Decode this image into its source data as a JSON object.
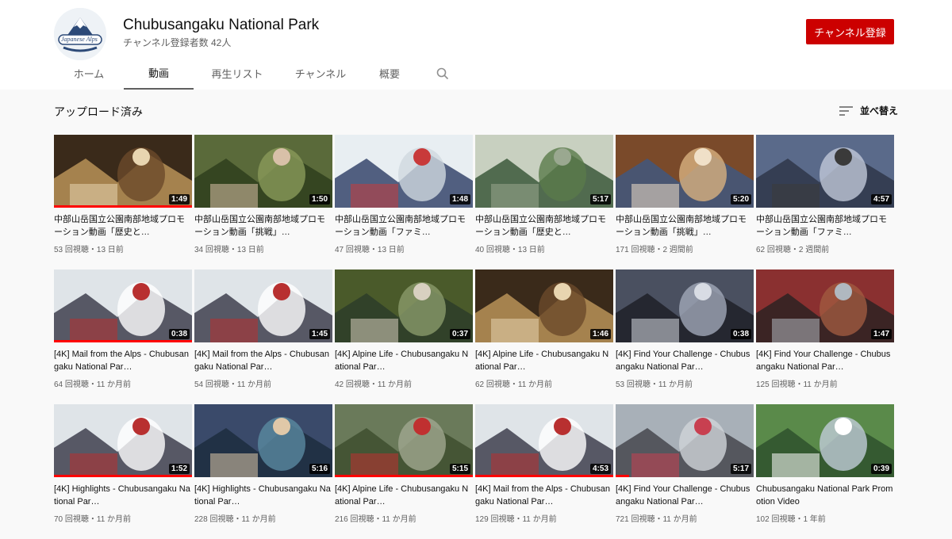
{
  "header": {
    "channel_name": "Chubusangaku National Park",
    "subscriber_count": "チャンネル登録者数 42人",
    "subscribe_label": "チャンネル登録",
    "avatar_text": "Japanese Alps"
  },
  "tabs": [
    {
      "label": "ホーム"
    },
    {
      "label": "動画"
    },
    {
      "label": "再生リスト"
    },
    {
      "label": "チャンネル"
    },
    {
      "label": "概要"
    }
  ],
  "section": {
    "title": "アップロード済み",
    "sort_label": "並べ替え"
  },
  "colors": {
    "subscribe": "#cc0000",
    "progress": "#ff0000"
  },
  "videos": [
    {
      "title": "中部山岳国立公園南部地域プロモーション動画「歴史と…",
      "meta": "53 回視聴・13 日前",
      "duration": "1:49",
      "progress": 1.0
    },
    {
      "title": "中部山岳国立公園南部地域プロモーション動画「挑戦」…",
      "meta": "34 回視聴・13 日前",
      "duration": "1:50",
      "progress": 0
    },
    {
      "title": "中部山岳国立公園南部地域プロモーション動画「ファミ…",
      "meta": "47 回視聴・13 日前",
      "duration": "1:48",
      "progress": 0
    },
    {
      "title": "中部山岳国立公園南部地域プロモーション動画「歴史と…",
      "meta": "40 回視聴・13 日前",
      "duration": "5:17",
      "progress": 0
    },
    {
      "title": "中部山岳国立公園南部地域プロモーション動画「挑戦」…",
      "meta": "171 回視聴・2 週間前",
      "duration": "5:20",
      "progress": 0
    },
    {
      "title": "中部山岳国立公園南部地域プロモーション動画「ファミ…",
      "meta": "62 回視聴・2 週間前",
      "duration": "4:57",
      "progress": 0
    },
    {
      "title": "[4K] Mail from the Alps - Chubusangaku National Par…",
      "meta": "64 回視聴・11 か月前",
      "duration": "0:38",
      "progress": 1.0
    },
    {
      "title": "[4K] Mail from the Alps - Chubusangaku National Par…",
      "meta": "54 回視聴・11 か月前",
      "duration": "1:45",
      "progress": 0
    },
    {
      "title": "[4K] Alpine Life - Chubusangaku National Par…",
      "meta": "42 回視聴・11 か月前",
      "duration": "0:37",
      "progress": 0
    },
    {
      "title": "[4K] Alpine Life - Chubusangaku National Par…",
      "meta": "62 回視聴・11 か月前",
      "duration": "1:46",
      "progress": 0
    },
    {
      "title": "[4K] Find Your Challenge - Chubusangaku National Par…",
      "meta": "53 回視聴・11 か月前",
      "duration": "0:38",
      "progress": 0
    },
    {
      "title": "[4K] Find Your Challenge - Chubusangaku National Par…",
      "meta": "125 回視聴・11 か月前",
      "duration": "1:47",
      "progress": 0
    },
    {
      "title": "[4K] Highlights - Chubusangaku National Par…",
      "meta": "70 回視聴・11 か月前",
      "duration": "1:52",
      "progress": 1.0
    },
    {
      "title": "[4K] Highlights - Chubusangaku National Par…",
      "meta": "228 回視聴・11 か月前",
      "duration": "5:16",
      "progress": 0
    },
    {
      "title": "[4K] Alpine Life - Chubusangaku National Par…",
      "meta": "216 回視聴・11 か月前",
      "duration": "5:15",
      "progress": 1.0
    },
    {
      "title": "[4K] Mail from the Alps - Chubusangaku National Par…",
      "meta": "129 回視聴・11 か月前",
      "duration": "4:53",
      "progress": 1.0
    },
    {
      "title": "[4K] Find Your Challenge - Chubusangaku National Par…",
      "meta": "721 回視聴・11 か月前",
      "duration": "5:17",
      "progress": 0.1
    },
    {
      "title": "Chubusangaku National Park Promotion Video",
      "meta": "102 回視聴・1 年前",
      "duration": "0:39",
      "progress": 0
    }
  ]
}
